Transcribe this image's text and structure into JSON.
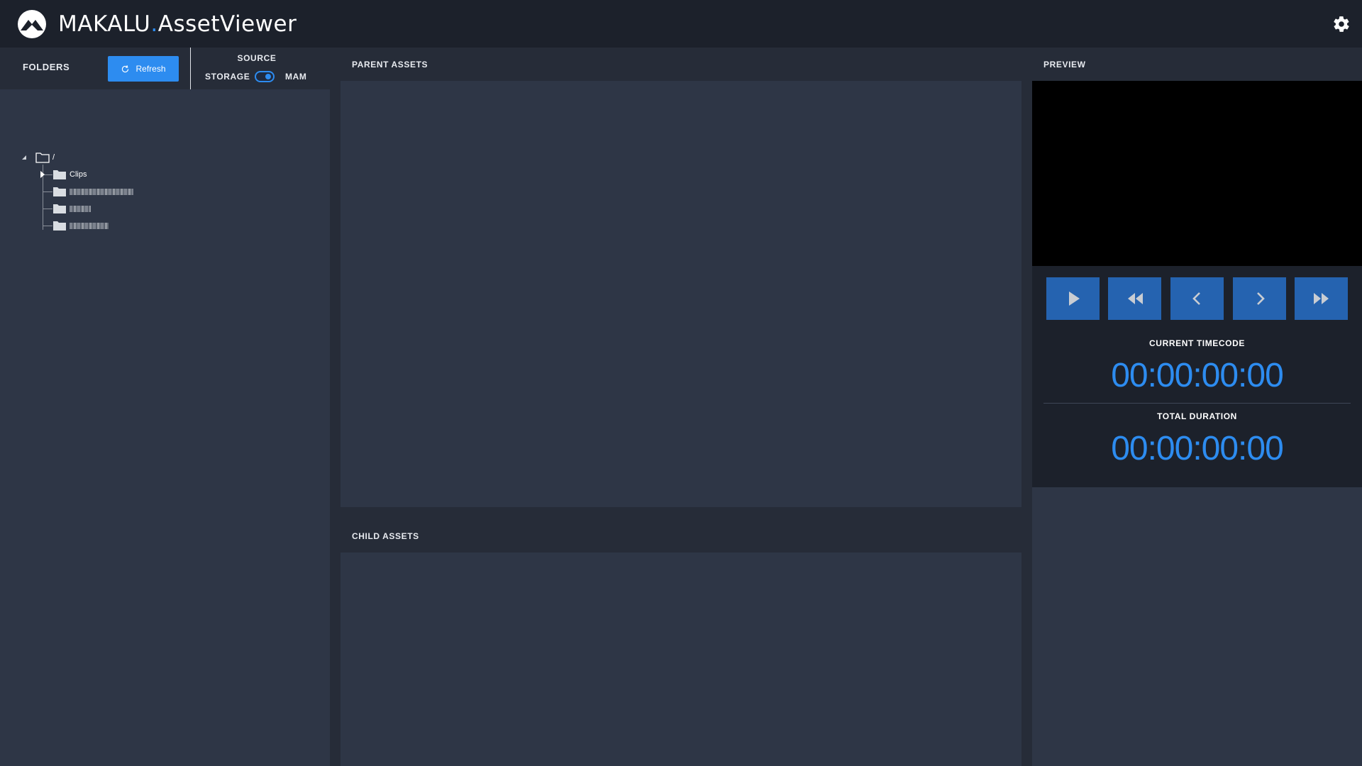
{
  "app": {
    "brand_main": "MAKALU",
    "brand_dot": ".",
    "brand_sub": "AssetViewer",
    "logo_icon": "mountain-logo-icon",
    "settings_icon": "gear-icon"
  },
  "colors": {
    "accent": "#2d8cf0",
    "button": "#2563b0",
    "topbar": "#1c212b",
    "panel_header": "#262c38",
    "panel_body": "#2e3646"
  },
  "folders": {
    "title": "FOLDERS",
    "refresh_label": "Refresh",
    "source": {
      "title": "SOURCE",
      "left_option": "STORAGE",
      "right_option": "MAM",
      "selected": "MAM"
    },
    "tree": {
      "root_label": "/",
      "children": [
        {
          "label": "Clips",
          "expandable": true,
          "blurred": false
        },
        {
          "label": "",
          "expandable": false,
          "blurred": true
        },
        {
          "label": "",
          "expandable": false,
          "blurred": true
        },
        {
          "label": "",
          "expandable": false,
          "blurred": true
        }
      ]
    }
  },
  "parent_assets": {
    "title": "PARENT ASSETS"
  },
  "child_assets": {
    "title": "CHILD ASSETS"
  },
  "preview": {
    "title": "PREVIEW",
    "controls": [
      {
        "name": "play",
        "icon": "play-icon"
      },
      {
        "name": "rewind",
        "icon": "rewind-icon"
      },
      {
        "name": "step-back",
        "icon": "chevron-left-icon"
      },
      {
        "name": "step-forward",
        "icon": "chevron-right-icon"
      },
      {
        "name": "fast-forward",
        "icon": "fast-forward-icon"
      }
    ],
    "current_timecode_label": "CURRENT TIMECODE",
    "current_timecode": "00:00:00:00",
    "total_duration_label": "TOTAL DURATION",
    "total_duration": "00:00:00:00"
  }
}
